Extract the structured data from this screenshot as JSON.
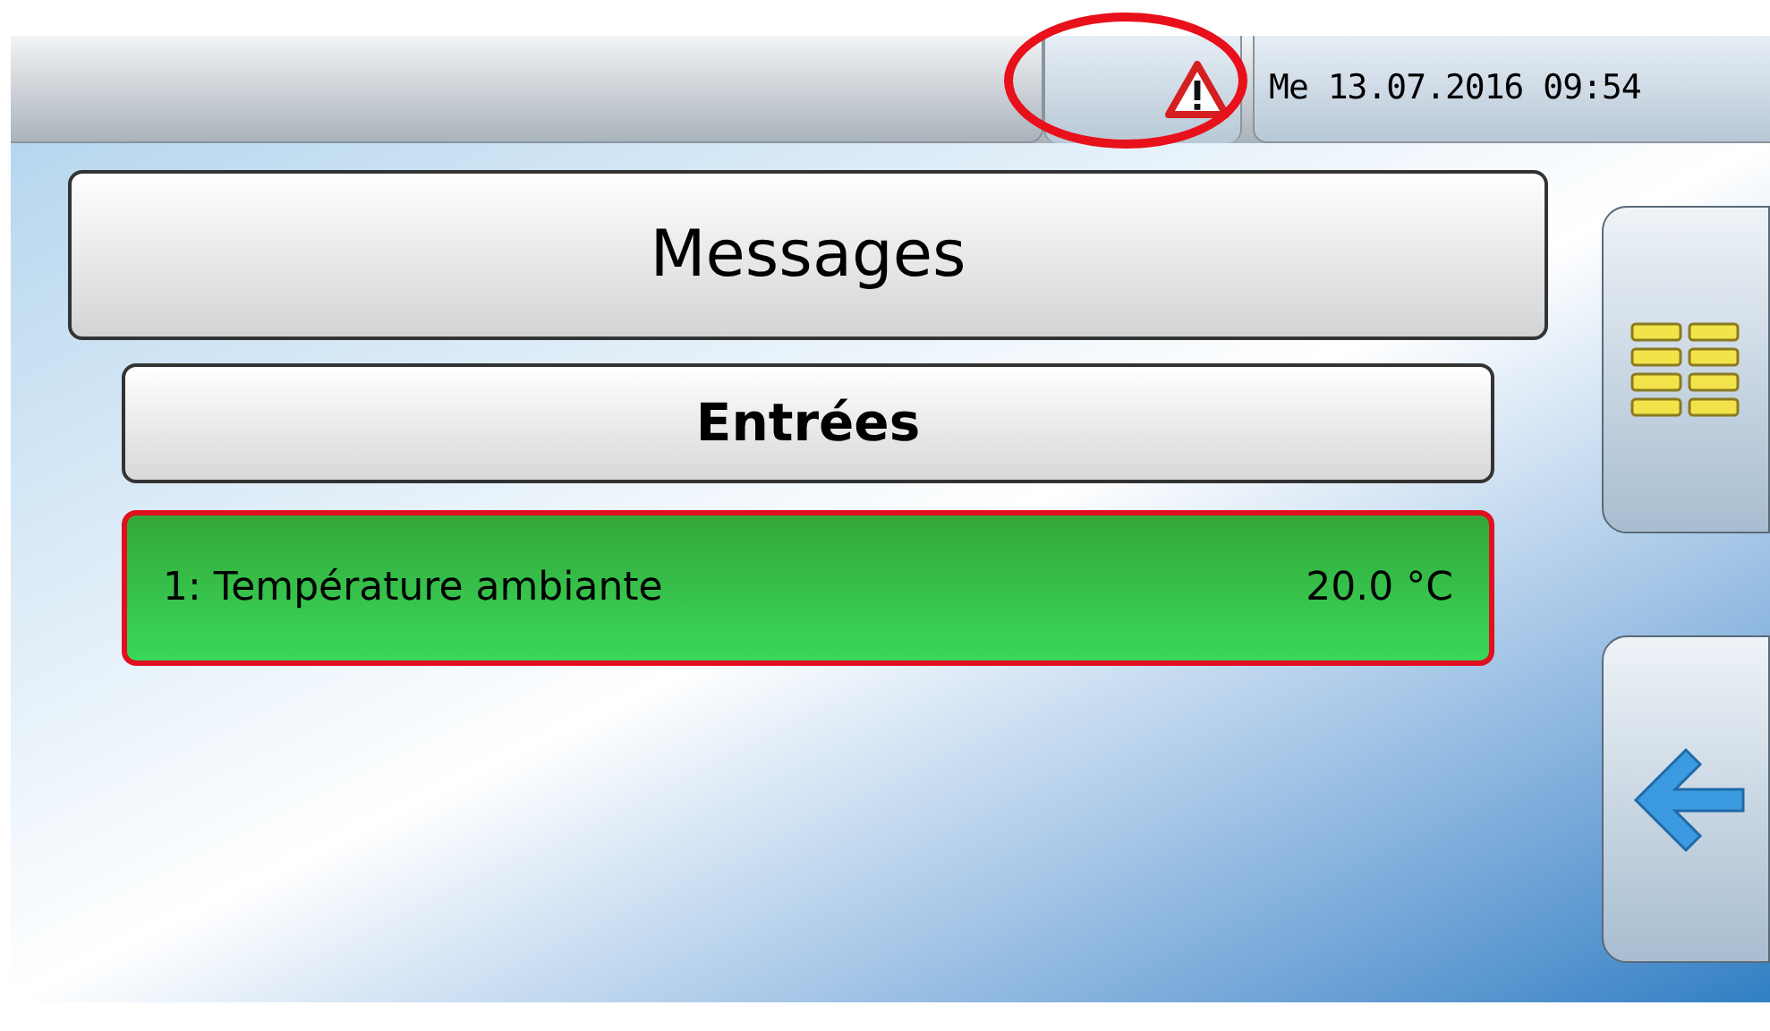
{
  "status_bar": {
    "warning_active": true,
    "datetime": "Me 13.07.2016 09:54"
  },
  "title": "Messages",
  "section": "Entrées",
  "messages": [
    {
      "label": "1: Température ambiante",
      "value": "20.0 °C",
      "alarm": true
    }
  ]
}
